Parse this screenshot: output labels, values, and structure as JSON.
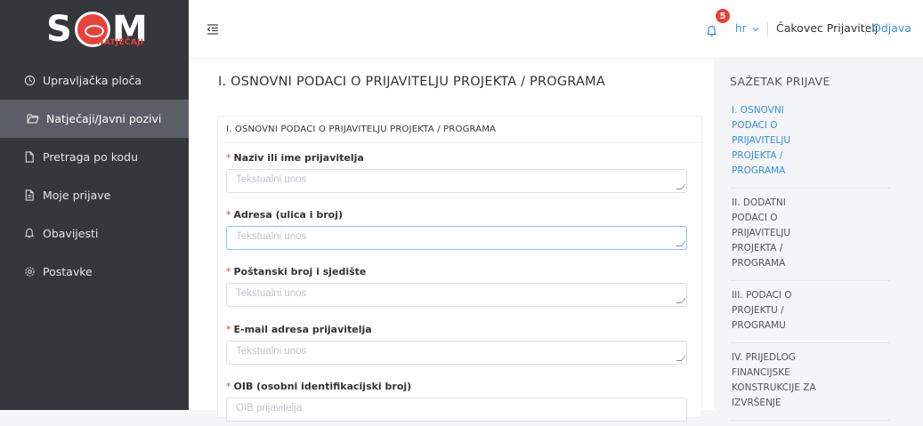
{
  "brand": {
    "logo_text_left": "S",
    "logo_text_right": "M",
    "logo_sub": "NATJEČAJI"
  },
  "sidebar": {
    "items": [
      {
        "label": "Upravljačka ploča",
        "icon": "gauge-icon"
      },
      {
        "label": "Natječaji/Javni pozivi",
        "icon": "folder-open-icon",
        "active": true
      },
      {
        "label": "Pretraga po kodu",
        "icon": "document-icon"
      },
      {
        "label": "Moje prijave",
        "icon": "document-list-icon"
      },
      {
        "label": "Obavijesti",
        "icon": "bell-icon"
      },
      {
        "label": "Postavke",
        "icon": "gear-icon"
      }
    ]
  },
  "topbar": {
    "notification_count": "5",
    "language": "hr",
    "user_name": "Čakovec Prijavitelj",
    "logout_label": "Odjava"
  },
  "main": {
    "page_title": "I. OSNOVNI PODACI O PRIJAVITELJU PROJEKTA / PROGRAMA",
    "card_title": "I. OSNOVNI PODACI O PRIJAVITELJU PROJEKTA / PROGRAMA",
    "fields": [
      {
        "label": "Naziv ili ime prijavitelja",
        "placeholder": "Tekstualni unos"
      },
      {
        "label": "Adresa (ulica i broj)",
        "placeholder": "Tekstualni unos"
      },
      {
        "label": "Poštanski broj i sjedište",
        "placeholder": "Tekstualni unos"
      },
      {
        "label": "E-mail adresa prijavitelja",
        "placeholder": "Tekstualni unos"
      },
      {
        "label": "OIB (osobni identifikacijski broj)",
        "placeholder": "OIB prijavitelja"
      }
    ]
  },
  "summary": {
    "title": "SAŽETAK PRIJAVE",
    "items": [
      "I. OSNOVNI PODACI O PRIJAVITELJU PROJEKTA / PROGRAMA",
      "II. DODATNI PODACI O PRIJAVITELJU PROJEKTA / PROGRAMA",
      "III. PODACI O PROJEKTU / PROGRAMU",
      "IV. PRIJEDLOG FINANCIJSKE KONSTRUKCIJE ZA IZVRŠENJE"
    ]
  },
  "colors": {
    "sidebar_bg": "#34373c",
    "accent": "#3a8ee6",
    "brand_red": "#e8413a"
  }
}
